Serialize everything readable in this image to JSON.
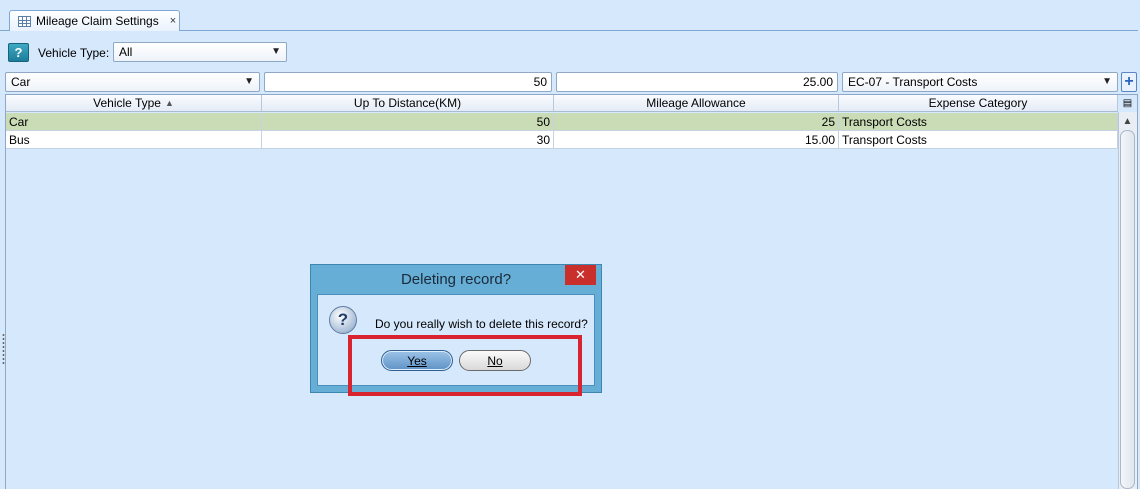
{
  "tab": {
    "title": "Mileage Claim Settings",
    "icon": "table-icon",
    "close": "×"
  },
  "filter": {
    "help_glyph": "?",
    "label": "Vehicle Type:",
    "value": "All"
  },
  "editor": {
    "vehicle_type": "Car",
    "distance": "50",
    "allowance": "25.00",
    "expense_category": "EC-07 - Transport Costs",
    "add_glyph": "+"
  },
  "table": {
    "columns": [
      {
        "label": "Vehicle Type",
        "sort": "▲"
      },
      {
        "label": "Up To Distance(KM)"
      },
      {
        "label": "Mileage Allowance"
      },
      {
        "label": "Expense Category"
      }
    ],
    "rows": [
      {
        "vehicle_type": "Car",
        "distance": "50",
        "allowance": "25",
        "category": "Transport Costs",
        "selected": true
      },
      {
        "vehicle_type": "Bus",
        "distance": "30",
        "allowance": "15.00",
        "category": "Transport Costs",
        "selected": false
      }
    ]
  },
  "dialog": {
    "title": "Deleting record?",
    "close_glyph": "✕",
    "icon": "question-icon",
    "icon_glyph": "?",
    "message": "Do you really wish to delete this record?",
    "yes_label": "Yes",
    "no_label": "No"
  },
  "colors": {
    "selected_row": "#c9dcb5",
    "highlight": "#d9232e",
    "dialog_frame": "#66aed6"
  }
}
